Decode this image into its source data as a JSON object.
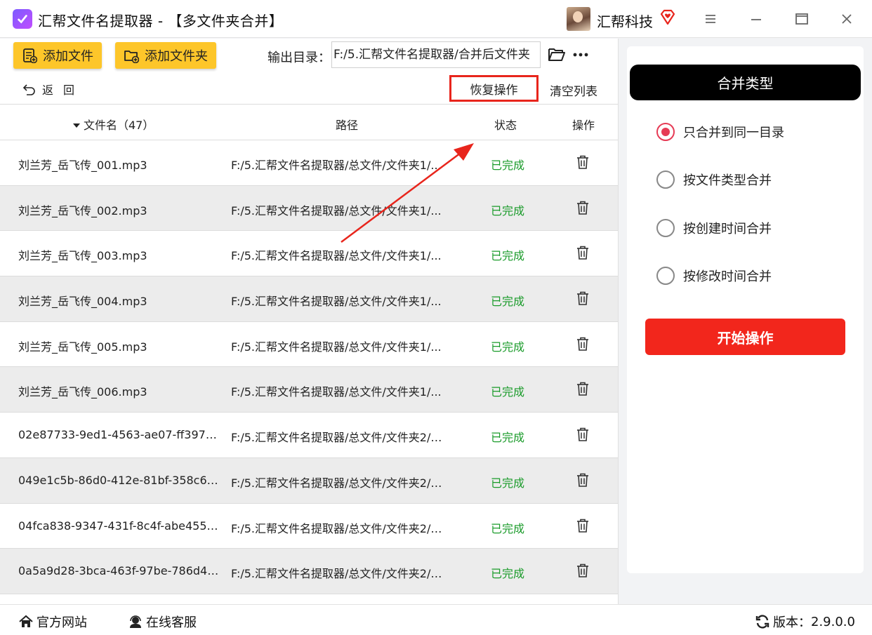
{
  "window": {
    "title": "汇帮文件名提取器 - 【多文件夹合并】",
    "user_name": "汇帮科技"
  },
  "toolbar": {
    "add_file_label": "添加文件",
    "add_folder_label": "添加文件夹",
    "output_dir_label": "输出目录：",
    "output_dir_value": "F:/5.汇帮文件名提取器/合并后文件夹",
    "back_label": "返回",
    "restore_label": "恢复操作",
    "clear_label": "清空列表"
  },
  "table": {
    "headers": {
      "name": "文件名（47）",
      "path": "路径",
      "status": "状态",
      "action": "操作"
    },
    "rows": [
      {
        "name": "刘兰芳_岳飞传_001.mp3",
        "path": "F:/5.汇帮文件名提取器/总文件/文件夹1/...",
        "status": "已完成"
      },
      {
        "name": "刘兰芳_岳飞传_002.mp3",
        "path": "F:/5.汇帮文件名提取器/总文件/文件夹1/...",
        "status": "已完成"
      },
      {
        "name": "刘兰芳_岳飞传_003.mp3",
        "path": "F:/5.汇帮文件名提取器/总文件/文件夹1/...",
        "status": "已完成"
      },
      {
        "name": "刘兰芳_岳飞传_004.mp3",
        "path": "F:/5.汇帮文件名提取器/总文件/文件夹1/...",
        "status": "已完成"
      },
      {
        "name": "刘兰芳_岳飞传_005.mp3",
        "path": "F:/5.汇帮文件名提取器/总文件/文件夹1/...",
        "status": "已完成"
      },
      {
        "name": "刘兰芳_岳飞传_006.mp3",
        "path": "F:/5.汇帮文件名提取器/总文件/文件夹1/...",
        "status": "已完成"
      },
      {
        "name": "02e87733-9ed1-4563-ae07-ff39701c...",
        "path": "F:/5.汇帮文件名提取器/总文件/文件夹2/0...",
        "status": "已完成"
      },
      {
        "name": "049e1c5b-86d0-412e-81bf-358c6e80...",
        "path": "F:/5.汇帮文件名提取器/总文件/文件夹2/0...",
        "status": "已完成"
      },
      {
        "name": "04fca838-9347-431f-8c4f-abe455e2a...",
        "path": "F:/5.汇帮文件名提取器/总文件/文件夹2/0...",
        "status": "已完成"
      },
      {
        "name": "0a5a9d28-3bca-463f-97be-786d418f...",
        "path": "F:/5.汇帮文件名提取器/总文件/文件夹2/0...",
        "status": "已完成"
      }
    ]
  },
  "merge_panel": {
    "title": "合并类型",
    "options": [
      {
        "label": "只合并到同一目录",
        "selected": true
      },
      {
        "label": "按文件类型合并",
        "selected": false
      },
      {
        "label": "按创建时间合并",
        "selected": false
      },
      {
        "label": "按修改时间合并",
        "selected": false
      }
    ],
    "start_label": "开始操作"
  },
  "footer": {
    "website_label": "官方网站",
    "support_label": "在线客服",
    "version_label": "版本：",
    "version_value": "2.9.0.0"
  },
  "colors": {
    "accent_yellow": "#fdc62a",
    "status_green": "#1a9b2a",
    "start_red": "#f2261c",
    "radio_pink": "#e63b55",
    "highlight_red": "#e8251c"
  },
  "icons": {
    "app_logo": "app-logo-icon",
    "vip": "diamond-heart-icon",
    "menu": "hamburger-icon",
    "minimize": "minimize-icon",
    "maximize": "maximize-icon",
    "close": "close-icon",
    "add_file": "add-file-icon",
    "add_folder": "add-folder-icon",
    "folder": "folder-open-icon",
    "more": "more-dots-icon",
    "back": "back-arrow-icon",
    "sort": "caret-down-icon",
    "delete": "trash-icon",
    "home": "home-icon",
    "support": "headset-icon",
    "refresh": "refresh-icon"
  }
}
